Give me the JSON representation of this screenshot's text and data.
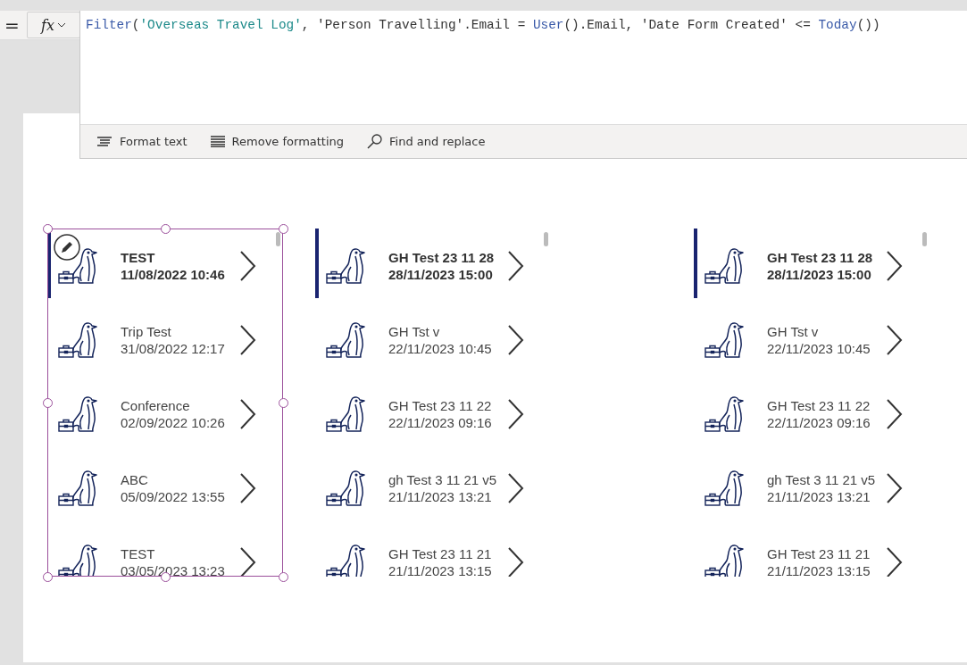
{
  "formula_bar": {
    "equals": "=",
    "fx_label": "fx",
    "formula": [
      {
        "kind": "function",
        "text": "Filter"
      },
      {
        "kind": "plain",
        "text": "("
      },
      {
        "kind": "string",
        "text": "'Overseas Travel Log'"
      },
      {
        "kind": "plain",
        "text": ", 'Person Travelling'.Email = "
      },
      {
        "kind": "function",
        "text": "User"
      },
      {
        "kind": "plain",
        "text": "().Email, 'Date Form Created' <= "
      },
      {
        "kind": "function",
        "text": "Today"
      },
      {
        "kind": "plain",
        "text": "())"
      }
    ],
    "toolbar": [
      {
        "kind": "format",
        "label": "Format text"
      },
      {
        "kind": "remove",
        "label": "Remove formatting"
      },
      {
        "kind": "find",
        "label": "Find and replace"
      }
    ]
  },
  "galleries": [
    {
      "selected": true,
      "rows": [
        {
          "title": "TEST",
          "date": "11/08/2022 10:46",
          "selected": true
        },
        {
          "title": "Trip Test",
          "date": "31/08/2022 12:17",
          "selected": false
        },
        {
          "title": "Conference",
          "date": "02/09/2022 10:26",
          "selected": false
        },
        {
          "title": "ABC",
          "date": "05/09/2022 13:55",
          "selected": false
        },
        {
          "title": "TEST",
          "date": "03/05/2023 13:23",
          "selected": false
        }
      ]
    },
    {
      "selected": false,
      "rows": [
        {
          "title": "GH Test 23 11 28",
          "date": "28/11/2023 15:00",
          "selected": true
        },
        {
          "title": "GH Tst v",
          "date": "22/11/2023 10:45",
          "selected": false
        },
        {
          "title": "GH Test 23 11 22",
          "date": "22/11/2023 09:16",
          "selected": false
        },
        {
          "title": "gh Test 3 11 21 v5",
          "date": "21/11/2023 13:21",
          "selected": false
        },
        {
          "title": "GH Test 23 11 21",
          "date": "21/11/2023 13:15",
          "selected": false
        }
      ]
    },
    {
      "selected": false,
      "rows": [
        {
          "title": "GH Test 23 11 28",
          "date": "28/11/2023 15:00",
          "selected": true
        },
        {
          "title": "GH Tst v",
          "date": "22/11/2023 10:45",
          "selected": false
        },
        {
          "title": "GH Test 23 11 22",
          "date": "22/11/2023 09:16",
          "selected": false
        },
        {
          "title": "gh Test 3 11 21 v5",
          "date": "21/11/2023 13:21",
          "selected": false
        },
        {
          "title": "GH Test 23 11 21",
          "date": "21/11/2023 13:15",
          "selected": false
        }
      ]
    }
  ]
}
